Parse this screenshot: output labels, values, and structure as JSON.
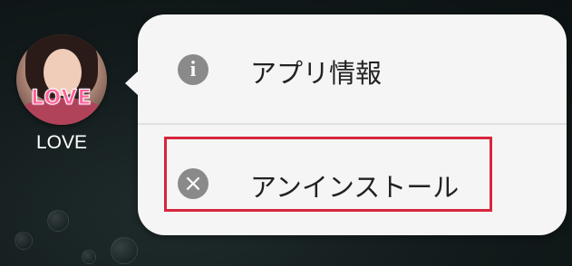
{
  "app": {
    "icon_text": "LOVE",
    "label": "LOVE"
  },
  "menu": {
    "app_info": {
      "label": "アプリ情報",
      "icon": "info-icon"
    },
    "uninstall": {
      "label": "アンインストール",
      "icon": "close-circle-icon"
    }
  },
  "colors": {
    "highlight": "#d7263d",
    "menu_bg": "#f5f5f5",
    "icon_grey": "#8a8a8a"
  }
}
